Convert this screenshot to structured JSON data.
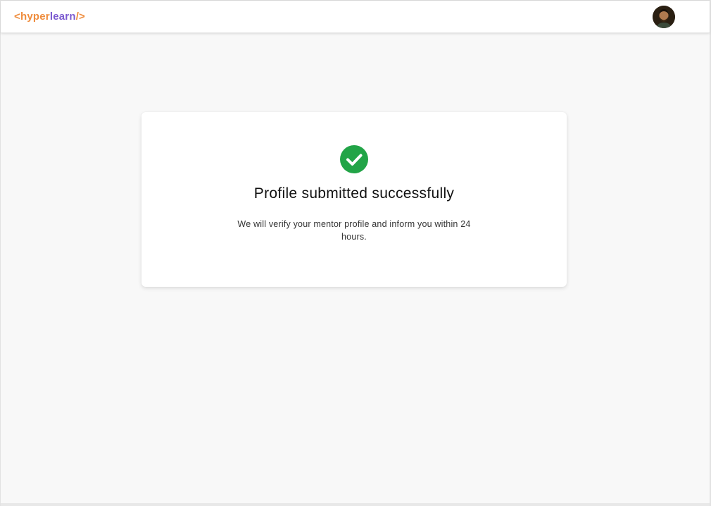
{
  "header": {
    "logo": {
      "open_bracket": "<",
      "part1": "hyper",
      "part2": "learn",
      "close_bracket": "/>"
    },
    "avatar_label": "user avatar"
  },
  "success_card": {
    "icon": "check-circle-icon",
    "title": "Profile submitted successfully",
    "message": "We will verify your mentor profile and inform you within 24 hours."
  },
  "colors": {
    "brand_orange": "#ef8c3c",
    "brand_purple": "#7c5bd0",
    "success_green": "#22a447",
    "page_background": "#f8f8f8"
  }
}
